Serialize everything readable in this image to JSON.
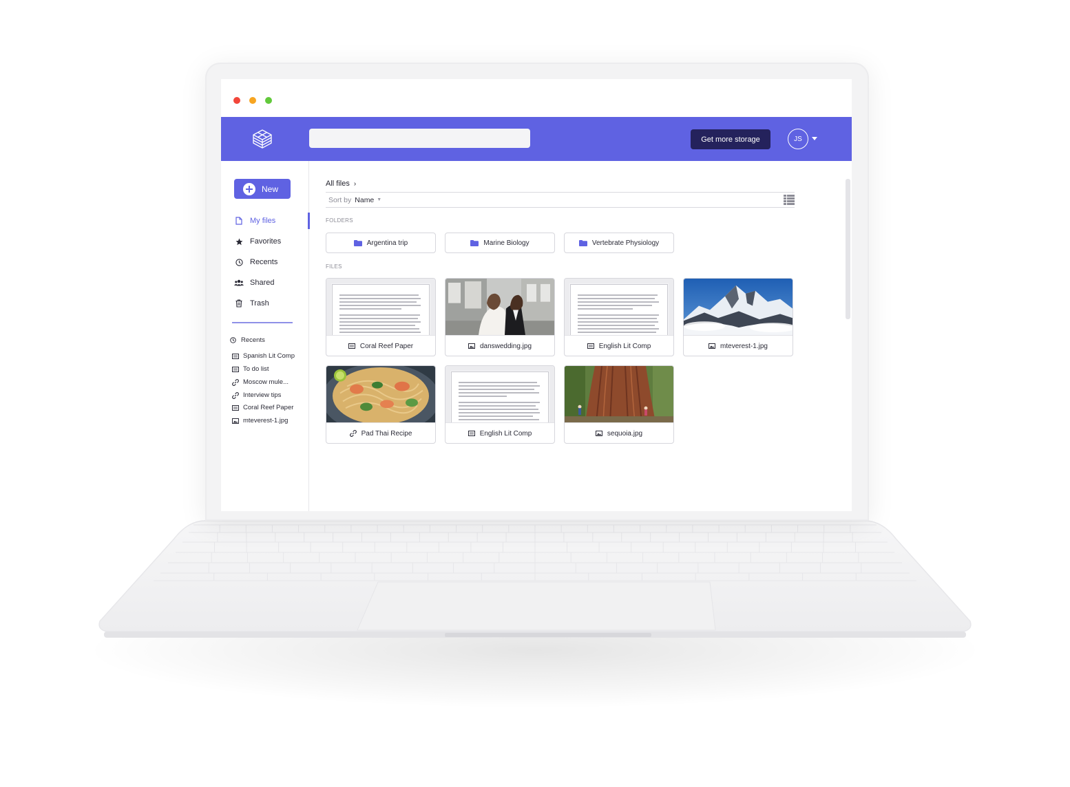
{
  "header": {
    "search_placeholder": "",
    "storage_button": "Get more storage",
    "avatar_initials": "JS",
    "accent_color": "#5f62e2",
    "dark_button_color": "#24225c"
  },
  "sidebar": {
    "new_button": "New",
    "nav": [
      {
        "label": "My files",
        "icon": "file-icon",
        "active": true
      },
      {
        "label": "Favorites",
        "icon": "star-icon",
        "active": false
      },
      {
        "label": "Recents",
        "icon": "clock-icon",
        "active": false
      },
      {
        "label": "Shared",
        "icon": "users-icon",
        "active": false
      },
      {
        "label": "Trash",
        "icon": "trash-icon",
        "active": false
      }
    ],
    "recents_heading": "Recents",
    "recents": [
      {
        "label": "Spanish Lit Comp",
        "icon": "document-icon"
      },
      {
        "label": "To do list",
        "icon": "document-icon"
      },
      {
        "label": "Moscow mule...",
        "icon": "link-icon"
      },
      {
        "label": "Interview tips",
        "icon": "link-icon"
      },
      {
        "label": "Coral Reef Paper",
        "icon": "document-icon"
      },
      {
        "label": "mteverest-1.jpg",
        "icon": "image-icon"
      }
    ]
  },
  "main": {
    "breadcrumb": "All files",
    "sort_label": "Sort by",
    "sort_value": "Name",
    "folders_label": "FOLDERS",
    "folders": [
      "Argentina trip",
      "Marine Biology",
      "Vertebrate Physiology"
    ],
    "files_label": "FILES",
    "files": [
      {
        "name": "Coral Reef Paper",
        "icon": "document-icon",
        "thumb": "document"
      },
      {
        "name": "danswedding.jpg",
        "icon": "image-icon",
        "thumb": "wedding-photo"
      },
      {
        "name": "English Lit Comp",
        "icon": "document-icon",
        "thumb": "document"
      },
      {
        "name": "mteverest-1.jpg",
        "icon": "image-icon",
        "thumb": "mountain-photo"
      },
      {
        "name": "Pad Thai Recipe",
        "icon": "link-icon",
        "thumb": "food-photo"
      },
      {
        "name": "English Lit Comp",
        "icon": "document-icon",
        "thumb": "document"
      },
      {
        "name": "sequoia.jpg",
        "icon": "image-icon",
        "thumb": "tree-photo"
      }
    ]
  }
}
